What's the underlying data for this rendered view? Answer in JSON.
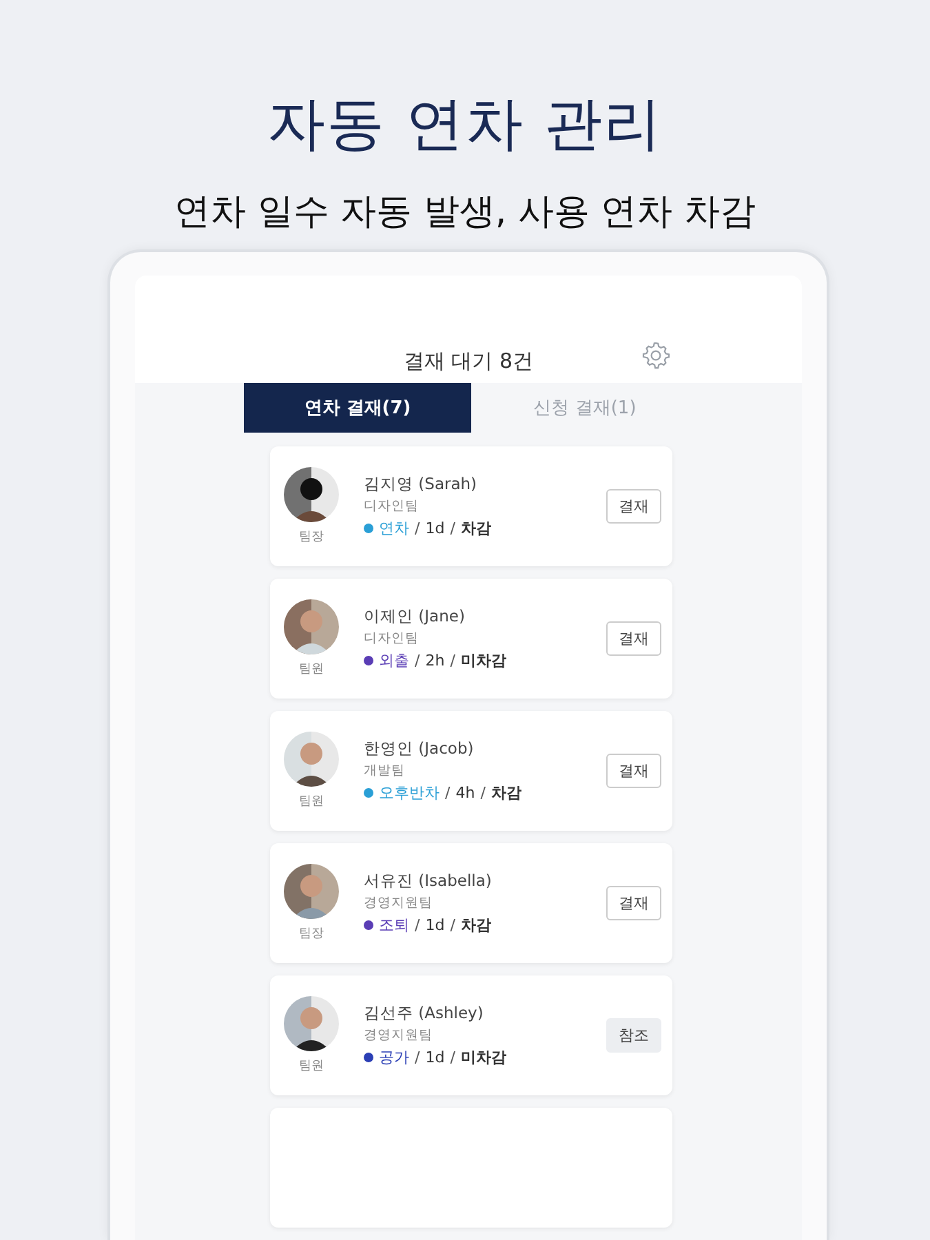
{
  "headline": "자동 연차 관리",
  "subheadline": "연차 일수 자동 발생, 사용 연차 차감",
  "header": {
    "title": "결재 대기 8건"
  },
  "tabs": [
    {
      "label": "연차 결재(7)",
      "selected": true
    },
    {
      "label": "신청 결재(1)",
      "selected": false
    }
  ],
  "requests": [
    {
      "name": "김지영 (Sarah)",
      "team": "디자인팀",
      "role": "팀장",
      "type": "연차",
      "color": "#2a9fd6",
      "duration": "1d",
      "deduction": "차감",
      "separators": [
        "/",
        "/"
      ],
      "button": {
        "label": "결재",
        "kind": "approve"
      }
    },
    {
      "name": "이제인 (Jane)",
      "team": "디자인팀",
      "role": "팀원",
      "type": "외출",
      "color": "#5a3db5",
      "duration": "2h",
      "deduction": "미차감",
      "separators": [
        "/",
        "/"
      ],
      "button": {
        "label": "결재",
        "kind": "approve"
      }
    },
    {
      "name": "한영인 (Jacob)",
      "team": "개발팀",
      "role": "팀원",
      "type": "오후반차",
      "color": "#2a9fd6",
      "duration": "4h",
      "deduction": "차감",
      "separators": [
        "/",
        "/"
      ],
      "button": {
        "label": "결재",
        "kind": "approve"
      }
    },
    {
      "name": "서유진 (Isabella)",
      "team": "경영지원팀",
      "role": "팀장",
      "type": "조퇴",
      "color": "#5a3db5",
      "duration": "1d",
      "deduction": "차감",
      "separators": [
        "/",
        "/"
      ],
      "button": {
        "label": "결재",
        "kind": "approve"
      }
    },
    {
      "name": "김선주 (Ashley)",
      "team": "경영지원팀",
      "role": "팀원",
      "type": "공가",
      "color": "#2b3fb5",
      "duration": "1d",
      "deduction": "미차감",
      "separators": [
        "/",
        "/"
      ],
      "button": {
        "label": "참조",
        "kind": "reference"
      }
    }
  ]
}
